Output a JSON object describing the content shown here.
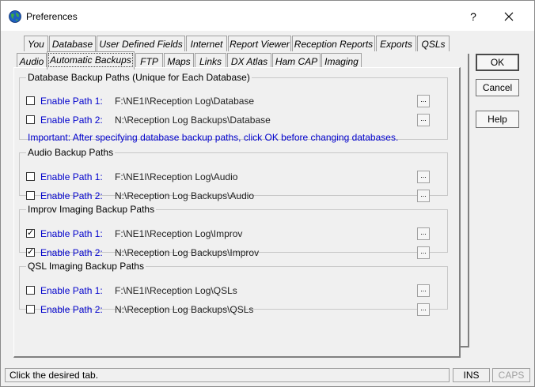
{
  "window": {
    "title": "Preferences",
    "help_label": "?",
    "icon": "globe-icon"
  },
  "tabs_row1": [
    {
      "label": "You"
    },
    {
      "label": "Database"
    },
    {
      "label": "User Defined Fields"
    },
    {
      "label": "Internet"
    },
    {
      "label": "Report Viewer"
    },
    {
      "label": "Reception Reports"
    },
    {
      "label": "Exports"
    },
    {
      "label": "QSLs"
    }
  ],
  "tabs_row2": [
    {
      "label": "Audio"
    },
    {
      "label": "Automatic Backups"
    },
    {
      "label": "FTP"
    },
    {
      "label": "Maps"
    },
    {
      "label": "Links"
    },
    {
      "label": "DX Atlas"
    },
    {
      "label": "Ham CAP"
    },
    {
      "label": "Imaging"
    }
  ],
  "active_tab": "Automatic Backups",
  "groups": [
    {
      "title": "Database Backup Paths (Unique for Each Database)",
      "rows": [
        {
          "label": "Enable Path 1:",
          "path": "F:\\NE1I\\Reception Log\\Database",
          "checked": false
        },
        {
          "label": "Enable Path 2:",
          "path": "N:\\Reception Log Backups\\Database",
          "checked": false
        }
      ],
      "note": "Important: After specifying database backup paths, click OK before changing databases."
    },
    {
      "title": "Audio Backup Paths",
      "rows": [
        {
          "label": "Enable Path 1:",
          "path": "F:\\NE1I\\Reception Log\\Audio",
          "checked": false
        },
        {
          "label": "Enable Path 2:",
          "path": "N:\\Reception Log Backups\\Audio",
          "checked": false
        }
      ]
    },
    {
      "title": "Improv Imaging Backup Paths",
      "rows": [
        {
          "label": "Enable Path 1:",
          "path": "F:\\NE1I\\Reception Log\\Improv",
          "checked": true
        },
        {
          "label": "Enable Path 2:",
          "path": "N:\\Reception Log Backups\\Improv",
          "checked": true
        }
      ]
    },
    {
      "title": "QSL Imaging Backup Paths",
      "rows": [
        {
          "label": "Enable Path 1:",
          "path": "F:\\NE1I\\Reception Log\\QSLs",
          "checked": false
        },
        {
          "label": "Enable Path 2:",
          "path": "N:\\Reception Log Backups\\QSLs",
          "checked": false
        }
      ]
    }
  ],
  "browse_label": "...",
  "buttons": {
    "ok": "OK",
    "cancel": "Cancel",
    "help": "Help"
  },
  "status": {
    "message": "Click the desired tab.",
    "ins": "INS",
    "caps": "CAPS"
  }
}
